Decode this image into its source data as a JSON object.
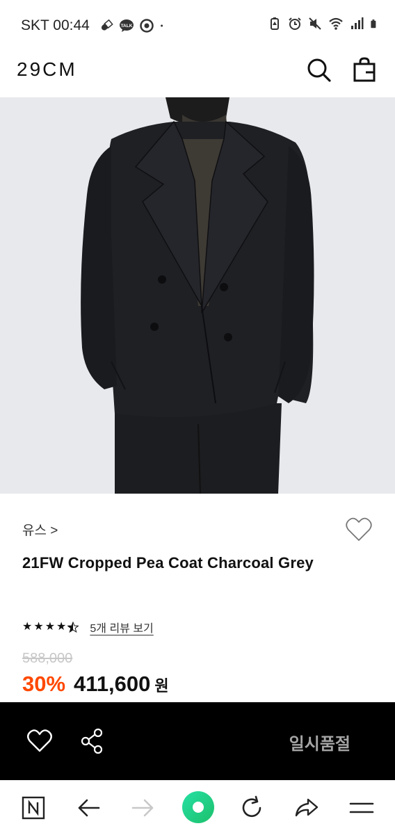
{
  "status_bar": {
    "carrier_time": "SKT 00:44",
    "left_icons": [
      "pill-icon",
      "talk-bubble-icon",
      "chrome-icon",
      "dot-icon"
    ],
    "right_icons": [
      "battery-saver-icon",
      "alarm-icon",
      "mute-icon",
      "wifi-icon",
      "signal-icon",
      "battery-icon"
    ],
    "talk_label": "TALK"
  },
  "header": {
    "logo": "29CM",
    "icons": [
      "search-icon",
      "shopping-bag-icon"
    ]
  },
  "product": {
    "brand": "유스 >",
    "title": "21FW Cropped Pea Coat Charcoal Grey",
    "rating_value": 4.5,
    "review_link": "5개 리뷰 보기",
    "original_price": "588,000",
    "discount": "30%",
    "sale_price": "411,600",
    "currency": "원",
    "discount_color": "#ff4800"
  },
  "action_bar": {
    "icons": [
      "heart-icon",
      "share-icon"
    ],
    "status_label": "일시품절"
  },
  "browser_nav": {
    "icons": [
      "n-home-icon",
      "back-arrow-icon",
      "forward-arrow-icon",
      "green-orb-icon",
      "refresh-icon",
      "share-arrow-icon",
      "menu-icon"
    ]
  }
}
